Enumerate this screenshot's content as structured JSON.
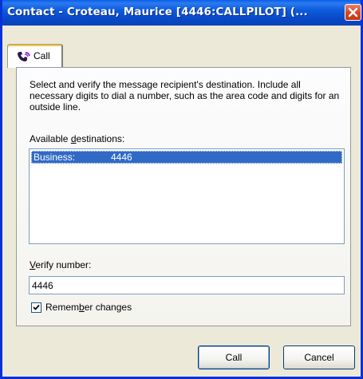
{
  "window": {
    "title": "Contact - Croteau, Maurice [4446:CALLPILOT] (...",
    "title_color": "#0a4ed6"
  },
  "tabs": [
    {
      "label": "Call",
      "icon": "phone-headset-icon",
      "selected": true
    }
  ],
  "panel": {
    "instructions": "Select and verify the message recipient's destination. Include all necessary digits to dial a number, such as the area code and digits for an outside line.",
    "available_label_pre": "Available ",
    "available_label_accel": "d",
    "available_label_post": "estinations:",
    "destinations": [
      {
        "type": "Business:",
        "number": "4446",
        "selected": true
      }
    ],
    "verify_label_accel": "V",
    "verify_label_post": "erify number:",
    "verify_value": "4446",
    "remember_pre": "Remem",
    "remember_accel": "b",
    "remember_post": "er changes",
    "remember_checked": true
  },
  "buttons": {
    "call": "Call",
    "cancel": "Cancel"
  },
  "colors": {
    "selection": "#316ac5",
    "dialog_bg": "#ece9d8"
  }
}
